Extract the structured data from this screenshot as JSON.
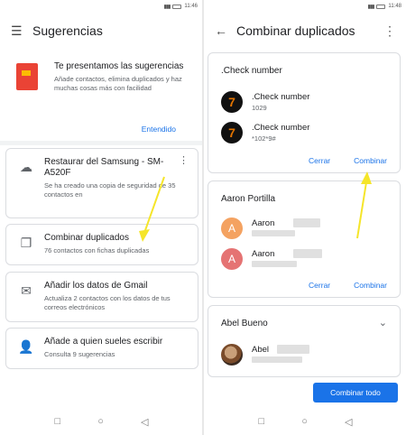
{
  "left": {
    "status_time": "11:46",
    "title": "Sugerencias",
    "intro": {
      "title": "Te presentamos las sugerencias",
      "text": "Añade contactos, elimina duplicados y haz muchas cosas más con facilidad",
      "ok_label": "Entendido"
    },
    "suggestions": [
      {
        "title": "Restaurar del Samsung - SM-A520F",
        "text": "Se ha creado una copia de seguridad de 35 contactos en"
      },
      {
        "title": "Combinar duplicados",
        "text": "76 contactos con fichas duplicadas"
      },
      {
        "title": "Añadir los datos de Gmail",
        "text": "Actualiza 2 contactos con los datos de tus correos electrónicos"
      },
      {
        "title": "Añade a quien sueles escribir",
        "text": "Consulta 9 sugerencias"
      }
    ]
  },
  "right": {
    "status_time": "11:48",
    "title": "Combinar duplicados",
    "groups": [
      {
        "name": ".Check number",
        "contacts": [
          {
            "initial": "7",
            "name": ".Check number",
            "detail": "1029"
          },
          {
            "initial": "7",
            "name": ".Check number",
            "detail": "*102*9#"
          }
        ],
        "cancel": "Cerrar",
        "combine": "Combinar"
      },
      {
        "name": "Aaron Portilla",
        "contacts": [
          {
            "initial": "A",
            "name": "Aaron",
            "detail": ""
          },
          {
            "initial": "A",
            "name": "Aaron",
            "detail": ""
          }
        ],
        "cancel": "Cerrar",
        "combine": "Combinar"
      },
      {
        "name": "Abel Bueno",
        "contacts": [
          {
            "initial": "",
            "name": "Abel",
            "detail": ""
          }
        ]
      }
    ],
    "combine_all": "Combinar todo"
  },
  "colors": {
    "accent": "#1a73e8",
    "annotation": "#f5e52a"
  },
  "icons": [
    "menu-icon",
    "back-arrow-icon",
    "more-vert-icon",
    "cloud-upload-icon",
    "copy-icon",
    "gmail-icon",
    "add-person-icon",
    "chevron-down-icon",
    "square-nav-icon",
    "circle-nav-icon",
    "triangle-nav-icon"
  ]
}
